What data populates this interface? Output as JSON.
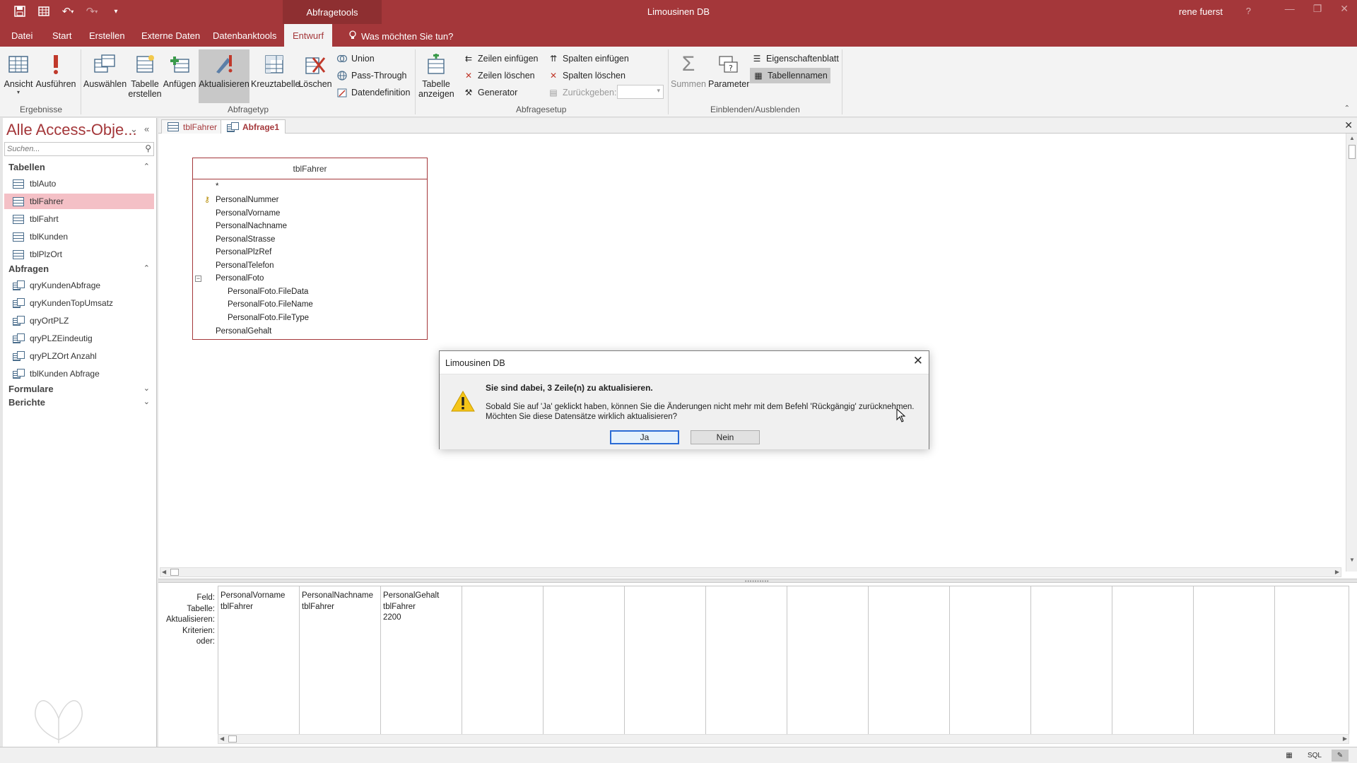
{
  "titlebar": {
    "context_tab": "Abfragetools",
    "app_title": "Limousinen DB",
    "user": "rene fuerst",
    "help": "?"
  },
  "tabs": [
    {
      "label": "Datei"
    },
    {
      "label": "Start"
    },
    {
      "label": "Erstellen"
    },
    {
      "label": "Externe Daten"
    },
    {
      "label": "Datenbanktools"
    },
    {
      "label": "Entwurf",
      "active": true
    }
  ],
  "tellme": "Was möchten Sie tun?",
  "ribbon": {
    "ansicht": "Ansicht",
    "ausfuehren": "Ausführen",
    "ergebnisse": "Ergebnisse",
    "auswaehlen": "Auswählen",
    "tabelle_erstellen_1": "Tabelle",
    "tabelle_erstellen_2": "erstellen",
    "anfuegen": "Anfügen",
    "aktualisieren": "Aktualisieren",
    "kreuztabelle": "Kreuztabelle",
    "loeschen": "Löschen",
    "union": "Union",
    "pass_through": "Pass-Through",
    "datendefinition": "Datendefinition",
    "abfragetyp": "Abfragetyp",
    "tabelle_anzeigen_1": "Tabelle",
    "tabelle_anzeigen_2": "anzeigen",
    "zeilen_einfuegen": "Zeilen einfügen",
    "zeilen_loeschen": "Zeilen löschen",
    "generator": "Generator",
    "spalten_einfuegen": "Spalten einfügen",
    "spalten_loeschen": "Spalten löschen",
    "zurueckgeben": "Zurückgeben:",
    "abfragesetup": "Abfragesetup",
    "summen": "Summen",
    "parameter": "Parameter",
    "eigenschaftenblatt": "Eigenschaftenblatt",
    "tabellennamen": "Tabellennamen",
    "einblenden": "Einblenden/Ausblenden"
  },
  "nav": {
    "title": "Alle Access-Obje...",
    "search_placeholder": "Suchen...",
    "tabellen": "Tabellen",
    "tables": [
      "tblAuto",
      "tblFahrer",
      "tblFahrt",
      "tblKunden",
      "tblPlzOrt"
    ],
    "abfragen": "Abfragen",
    "queries": [
      "qryKundenAbfrage",
      "qryKundenTopUmsatz",
      "qryOrtPLZ",
      "qryPLZEindeutig",
      "qryPLZOrt Anzahl",
      "tblKunden Abfrage"
    ],
    "formulare": "Formulare",
    "berichte": "Berichte"
  },
  "doctabs": [
    "tblFahrer",
    "Abfrage1"
  ],
  "fieldlist": {
    "title": "tblFahrer",
    "fields": [
      "*",
      "PersonalNummer",
      "PersonalVorname",
      "PersonalNachname",
      "PersonalStrasse",
      "PersonalPlzRef",
      "PersonalTelefon",
      "PersonalFoto",
      "PersonalFoto.FileData",
      "PersonalFoto.FileName",
      "PersonalFoto.FileType",
      "PersonalGehalt"
    ]
  },
  "grid": {
    "row_labels": [
      "Feld:",
      "Tabelle:",
      "Aktualisieren:",
      "Kriterien:",
      "oder:"
    ],
    "columns": [
      {
        "feld": "PersonalVorname",
        "tabelle": "tblFahrer",
        "aktualisieren": ""
      },
      {
        "feld": "PersonalNachname",
        "tabelle": "tblFahrer",
        "aktualisieren": ""
      },
      {
        "feld": "PersonalGehalt",
        "tabelle": "tblFahrer",
        "aktualisieren": "2200"
      }
    ]
  },
  "statusbar": {
    "sql": "SQL"
  },
  "dialog": {
    "title": "Limousinen DB",
    "headline": "Sie sind dabei, 3 Zeile(n) zu aktualisieren.",
    "line1": "Sobald Sie auf 'Ja' geklickt haben, können Sie die Änderungen nicht mehr mit dem Befehl 'Rückgängig' zurücknehmen.",
    "line2": "Möchten Sie diese Datensätze wirklich aktualisieren?",
    "yes": "Ja",
    "no": "Nein"
  },
  "colors": {
    "accent": "#a4373a",
    "selected_nav": "#f4c0c6"
  }
}
